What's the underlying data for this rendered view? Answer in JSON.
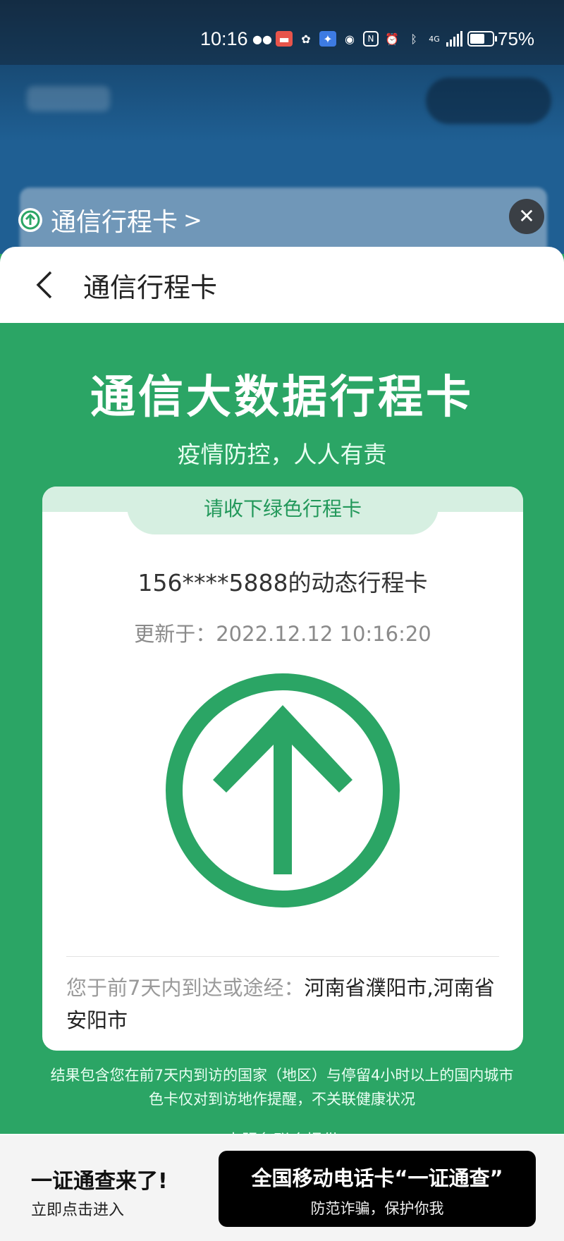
{
  "status_bar": {
    "time": "10:16",
    "battery": "75%",
    "network": "4G"
  },
  "mini_program": {
    "title": "通信行程卡",
    "chevron": ">"
  },
  "navbar": {
    "title": "通信行程卡"
  },
  "page": {
    "main_title": "通信大数据行程卡",
    "subtitle": "疫情防控，人人有责"
  },
  "card": {
    "tab_label": "请收下绿色行程卡",
    "phone_line": "156****5888的动态行程卡",
    "updated": "更新于：2022.12.12 10:16:20",
    "arrow_color": "#2ba565",
    "visited_label": "您于前7天内到达或途经：",
    "visited_places": "河南省濮阳市,河南省安阳市"
  },
  "notes": {
    "line1": "结果包含您在前7天内到访的国家（地区）与停留4小时以上的国内城市",
    "line2": "色卡仅对到访地作提醒，不关联健康状况",
    "line3": "本服务联合提供"
  },
  "banner": {
    "headline": "一证通查来了!",
    "sub": "立即点击进入",
    "button_title": "全国移动电话卡“一证通查”",
    "button_sub": "防范诈骗，保护你我"
  },
  "colors": {
    "brand_green": "#2ba565",
    "tab_green": "#d6efe1"
  }
}
